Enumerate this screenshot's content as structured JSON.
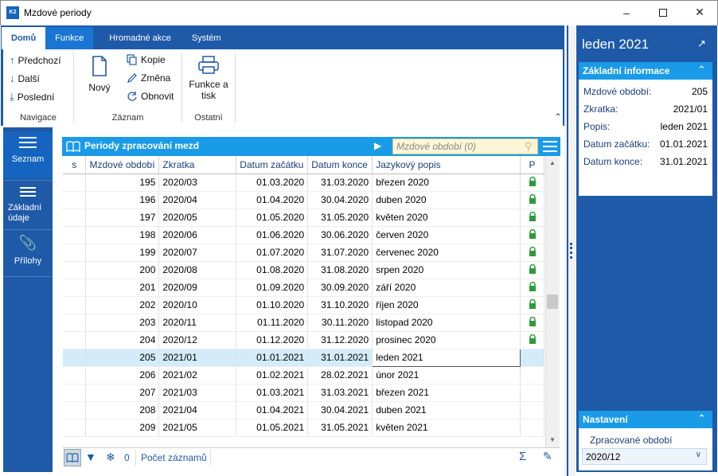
{
  "window": {
    "title": "Mzdové periody",
    "app_icon_text": "K2"
  },
  "ribbon": {
    "tabs": [
      {
        "label": "Domů"
      },
      {
        "label": "Funkce"
      },
      {
        "label": "Hromadné akce"
      },
      {
        "label": "Systém"
      }
    ],
    "navigace": {
      "label": "Navigace",
      "prev": "Předchozí",
      "next": "Další",
      "last": "Poslední"
    },
    "zaznam": {
      "label": "Záznam",
      "new": "Nový",
      "copy": "Kopie",
      "change": "Změna",
      "refresh": "Obnovit"
    },
    "ostatni": {
      "label": "Ostatní",
      "print": "Funkce a tisk"
    }
  },
  "leftnav": {
    "items": [
      {
        "label": "Seznam"
      },
      {
        "label": "Základní údaje"
      },
      {
        "label": "Přílohy"
      }
    ]
  },
  "grid": {
    "title": "Periody zpracování mezd",
    "search_placeholder": "Mzdové období (0)",
    "columns": [
      "s",
      "Mzdové období",
      "Zkratka",
      "Datum začátku",
      "Datum konce",
      "Jazykový popis",
      "P"
    ],
    "rows": [
      {
        "id": "195",
        "code": "2020/03",
        "start": "01.03.2020",
        "end": "31.03.2020",
        "desc": "březen 2020",
        "locked": true
      },
      {
        "id": "196",
        "code": "2020/04",
        "start": "01.04.2020",
        "end": "30.04.2020",
        "desc": "duben 2020",
        "locked": true
      },
      {
        "id": "197",
        "code": "2020/05",
        "start": "01.05.2020",
        "end": "31.05.2020",
        "desc": "květen 2020",
        "locked": true
      },
      {
        "id": "198",
        "code": "2020/06",
        "start": "01.06.2020",
        "end": "30.06.2020",
        "desc": "červen 2020",
        "locked": true
      },
      {
        "id": "199",
        "code": "2020/07",
        "start": "01.07.2020",
        "end": "31.07.2020",
        "desc": "červenec 2020",
        "locked": true
      },
      {
        "id": "200",
        "code": "2020/08",
        "start": "01.08.2020",
        "end": "31.08.2020",
        "desc": "srpen 2020",
        "locked": true
      },
      {
        "id": "201",
        "code": "2020/09",
        "start": "01.09.2020",
        "end": "30.09.2020",
        "desc": "září 2020",
        "locked": true
      },
      {
        "id": "202",
        "code": "2020/10",
        "start": "01.10.2020",
        "end": "31.10.2020",
        "desc": "říjen 2020",
        "locked": true
      },
      {
        "id": "203",
        "code": "2020/11",
        "start": "01.11.2020",
        "end": "30.11.2020",
        "desc": "listopad 2020",
        "locked": true
      },
      {
        "id": "204",
        "code": "2020/12",
        "start": "01.12.2020",
        "end": "31.12.2020",
        "desc": "prosinec 2020",
        "locked": true
      },
      {
        "id": "205",
        "code": "2021/01",
        "start": "01.01.2021",
        "end": "31.01.2021",
        "desc": "leden 2021",
        "locked": false,
        "selected": true
      },
      {
        "id": "206",
        "code": "2021/02",
        "start": "01.02.2021",
        "end": "28.02.2021",
        "desc": "únor 2021",
        "locked": false
      },
      {
        "id": "207",
        "code": "2021/03",
        "start": "01.03.2021",
        "end": "31.03.2021",
        "desc": "březen 2021",
        "locked": false
      },
      {
        "id": "208",
        "code": "2021/04",
        "start": "01.04.2021",
        "end": "30.04.2021",
        "desc": "duben 2021",
        "locked": false
      },
      {
        "id": "209",
        "code": "2021/05",
        "start": "01.05.2021",
        "end": "31.05.2021",
        "desc": "květen 2021",
        "locked": false
      }
    ],
    "status": {
      "filter_count": "0",
      "record_count_label": "Počet záznamů"
    }
  },
  "rightpanel": {
    "title": "leden 2021",
    "info_header": "Základní informace",
    "fields": [
      {
        "label": "Mzdové období:",
        "value": "205"
      },
      {
        "label": "Zkratka:",
        "value": "2021/01"
      },
      {
        "label": "Popis:",
        "value": "leden 2021"
      },
      {
        "label": "Datum začátku:",
        "value": "01.01.2021"
      },
      {
        "label": "Datum konce:",
        "value": "31.01.2021"
      }
    ],
    "settings_header": "Nastavení",
    "settings_label": "Zpracované období",
    "settings_value": "2020/12"
  },
  "colors": {
    "ribbon_blue": "#1e5aa8",
    "header_cyan": "#1a9be8",
    "lock_green": "#2e9b3a",
    "selected_row": "#d4ecf9"
  }
}
